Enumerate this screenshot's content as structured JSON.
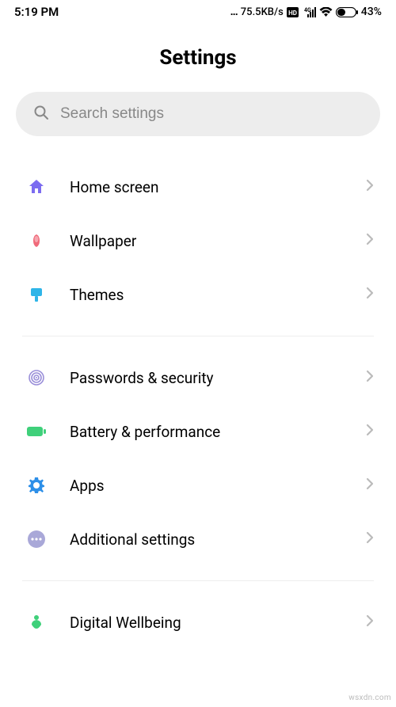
{
  "status": {
    "time": "5:19 PM",
    "dots": "...",
    "speed": "75.5KB/s",
    "battery": "43%"
  },
  "title": "Settings",
  "search": {
    "placeholder": "Search settings"
  },
  "group1": [
    {
      "label": "Home screen",
      "icon": "home-icon",
      "color": "#7c6cf0"
    },
    {
      "label": "Wallpaper",
      "icon": "flower-icon",
      "color": "#f06a7a"
    },
    {
      "label": "Themes",
      "icon": "brush-icon",
      "color": "#2fb5e8"
    }
  ],
  "group2": [
    {
      "label": "Passwords & security",
      "icon": "fingerprint-icon",
      "color": "#9a8fd9"
    },
    {
      "label": "Battery & performance",
      "icon": "battery-icon",
      "color": "#3fd07a"
    },
    {
      "label": "Apps",
      "icon": "gear-icon",
      "color": "#2d8fe8"
    },
    {
      "label": "Additional settings",
      "icon": "dots-icon",
      "color": "#a9a8d8"
    }
  ],
  "group3": [
    {
      "label": "Digital Wellbeing",
      "icon": "wellbeing-icon",
      "color": "#3fd07a"
    }
  ],
  "watermark": "wsxdn.com"
}
